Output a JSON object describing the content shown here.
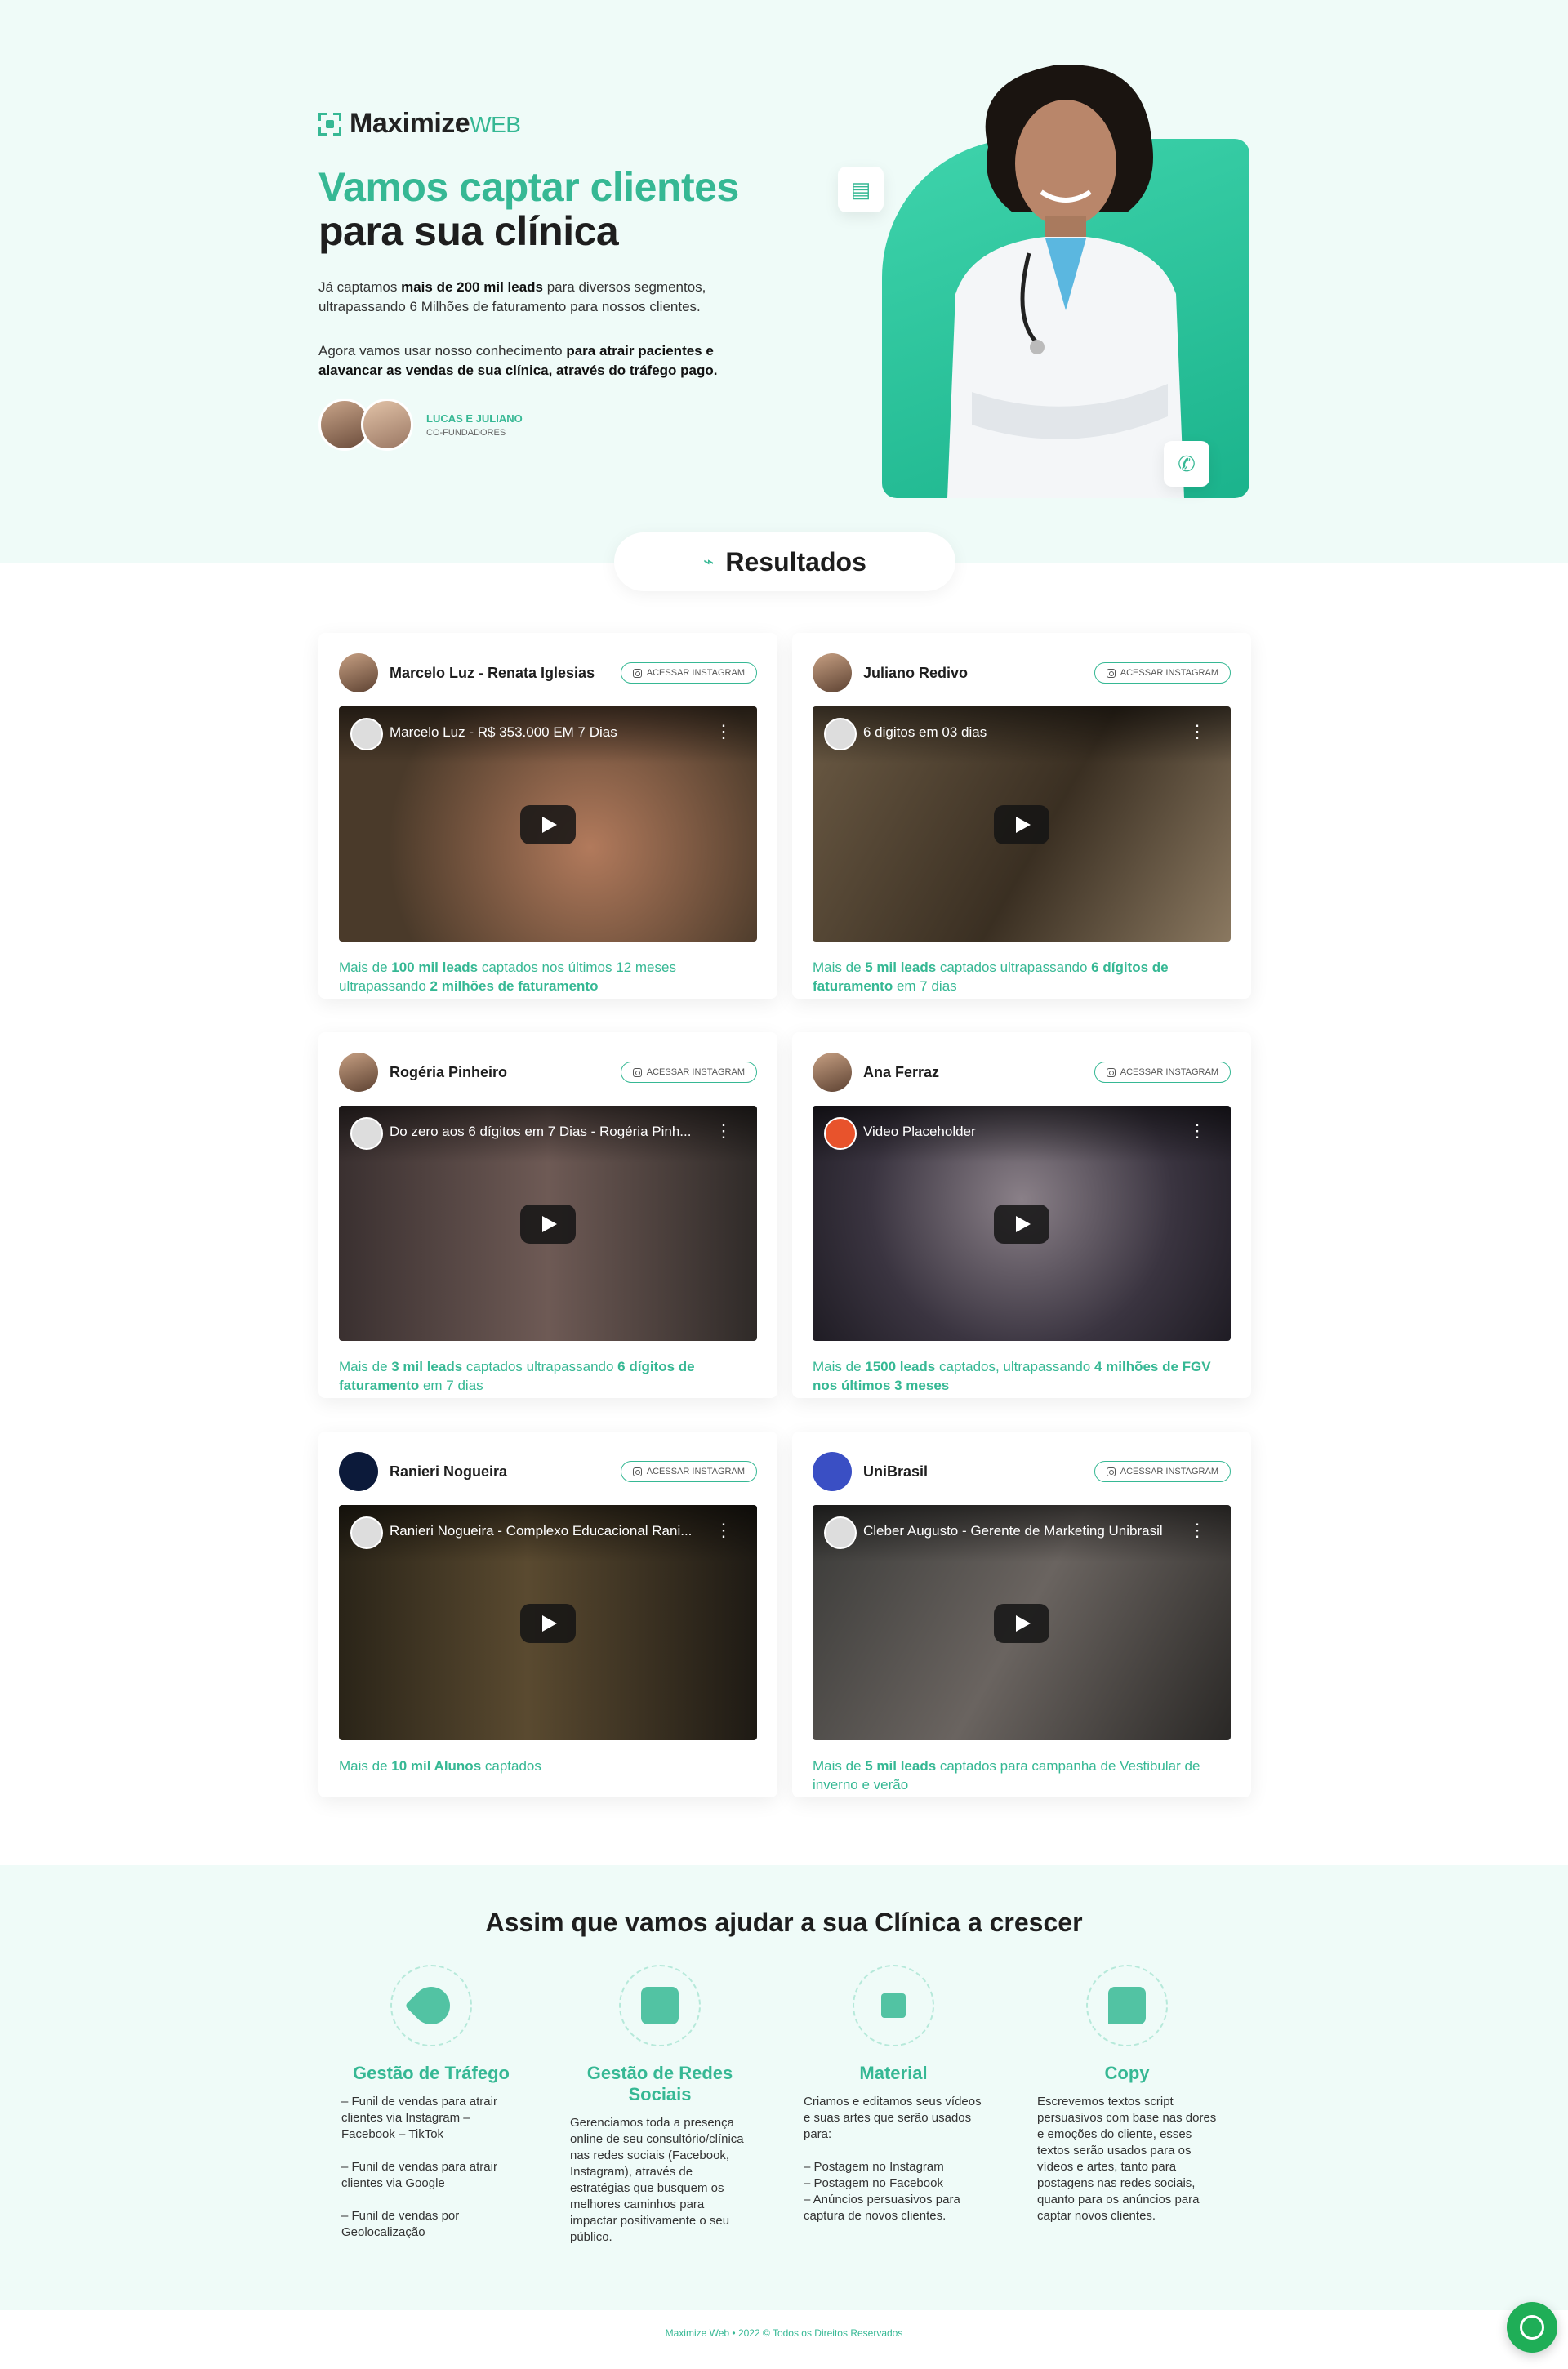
{
  "hero": {
    "logo_main": "Maximize",
    "logo_sub": "WEB",
    "title_line1": "Vamos captar clientes",
    "title_line2": "para sua clínica",
    "p1_a": "Já captamos ",
    "p1_b": "mais de 200 mil leads",
    "p1_c": " para diversos segmentos, ultrapassando 6 Milhões de faturamento para nossos clientes.",
    "p2_a": "Agora vamos usar nosso conhecimento ",
    "p2_b": "para atrair pacientes e alavancar as vendas de sua clínica, através do tráfego pago.",
    "founders_name": "LUCAS E JULIANO",
    "founders_role": "CO-FUNDADORES"
  },
  "results_label": "Resultados",
  "insta_label": "ACESSAR INSTAGRAM",
  "cards": [
    {
      "name": "Marcelo Luz - Renata Iglesias",
      "video_title": "Marcelo Luz - R$ 353.000 EM 7 Dias",
      "t1": "Mais de ",
      "b1": "100 mil leads",
      "t2": " captados nos últimos 12 meses ultrapassando ",
      "b2": "2 milhões de faturamento",
      "t3": ""
    },
    {
      "name": "Juliano Redivo",
      "video_title": "6 digitos em 03 dias",
      "t1": "Mais de ",
      "b1": "5 mil leads",
      "t2": " captados ultrapassando ",
      "b2": "6 dígitos de faturamento",
      "t3": " em 7 dias"
    },
    {
      "name": "Rogéria Pinheiro",
      "video_title": "Do zero aos 6 dígitos em 7 Dias - Rogéria Pinh...",
      "t1": "Mais de ",
      "b1": "3 mil leads",
      "t2": " captados ultrapassando ",
      "b2": "6 dígitos de faturamento",
      "t3": " em 7 dias"
    },
    {
      "name": "Ana Ferraz",
      "video_title": "Video Placeholder",
      "t1": "Mais de ",
      "b1": "1500 leads",
      "t2": " captados, ultrapassando ",
      "b2": "4 milhões de FGV nos últimos 3 meses",
      "t3": ""
    },
    {
      "name": "Ranieri Nogueira",
      "video_title": "Ranieri Nogueira - Complexo Educacional Rani...",
      "t1": "Mais de ",
      "b1": "10 mil Alunos",
      "t2": " captados",
      "b2": "",
      "t3": ""
    },
    {
      "name": "UniBrasil",
      "video_title": "Cleber Augusto - Gerente de Marketing Unibrasil",
      "t1": "Mais de ",
      "b1": "5 mil leads",
      "t2": " captados para campanha de Vestibular de inverno e verão",
      "b2": "",
      "t3": ""
    }
  ],
  "help": {
    "title": "Assim que vamos ajudar a sua Clínica a crescer",
    "services": [
      {
        "name": "Gestão de Tráfego",
        "desc": "– Funil de vendas para atrair clientes via Instagram – Facebook – TikTok\n\n– Funil de vendas para atrair clientes via Google\n\n– Funil de vendas por Geolocalização"
      },
      {
        "name": "Gestão de Redes Sociais",
        "desc": "Gerenciamos toda a presença online de seu consultório/clínica nas redes sociais (Facebook, Instagram), através de estratégias que busquem os melhores caminhos para impactar positivamente o seu público."
      },
      {
        "name": "Material",
        "desc": "Criamos e editamos seus vídeos e suas artes que serão usados para:\n\n– Postagem no Instagram\n– Postagem no Facebook\n– Anúncios persuasivos para captura de novos clientes."
      },
      {
        "name": "Copy",
        "desc": "Escrevemos textos script persuasivos com base nas dores e emoções do cliente, esses textos serão usados para os vídeos e artes, tanto para postagens nas redes sociais, quanto para os anúncios para captar novos clientes."
      }
    ]
  },
  "footer": "Maximize Web • 2022 © Todos os Direitos Reservados",
  "colors": {
    "accent": "#36b894",
    "hero_bg": "#effbf8",
    "whatsapp": "#1fae57"
  }
}
